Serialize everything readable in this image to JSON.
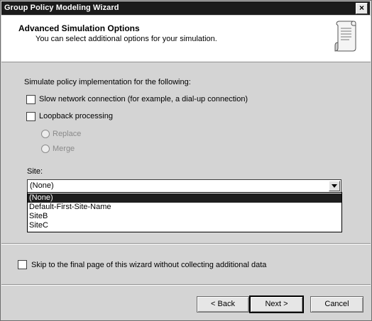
{
  "window": {
    "title": "Group Policy Modeling Wizard",
    "close_label": "×"
  },
  "header": {
    "title": "Advanced Simulation Options",
    "subtitle": "You can select additional options for your simulation.",
    "icon": "scroll-icon"
  },
  "options": {
    "intro": "Simulate policy implementation for the following:",
    "slow_network": {
      "label": "Slow network connection (for example, a dial-up connection)",
      "checked": false
    },
    "loopback": {
      "label": "Loopback processing",
      "checked": false
    },
    "replace": {
      "label": "Replace",
      "enabled": false
    },
    "merge": {
      "label": "Merge",
      "enabled": false
    }
  },
  "site": {
    "label": "Site:",
    "value": "(None)",
    "items": [
      "(None)",
      "Default-First-Site-Name",
      "SiteB",
      "SiteC"
    ],
    "selected_index": 0
  },
  "skip": {
    "label": "Skip to the final page of this wizard without collecting additional data",
    "checked": false
  },
  "buttons": {
    "back": "< Back",
    "next": "Next >",
    "cancel": "Cancel"
  }
}
